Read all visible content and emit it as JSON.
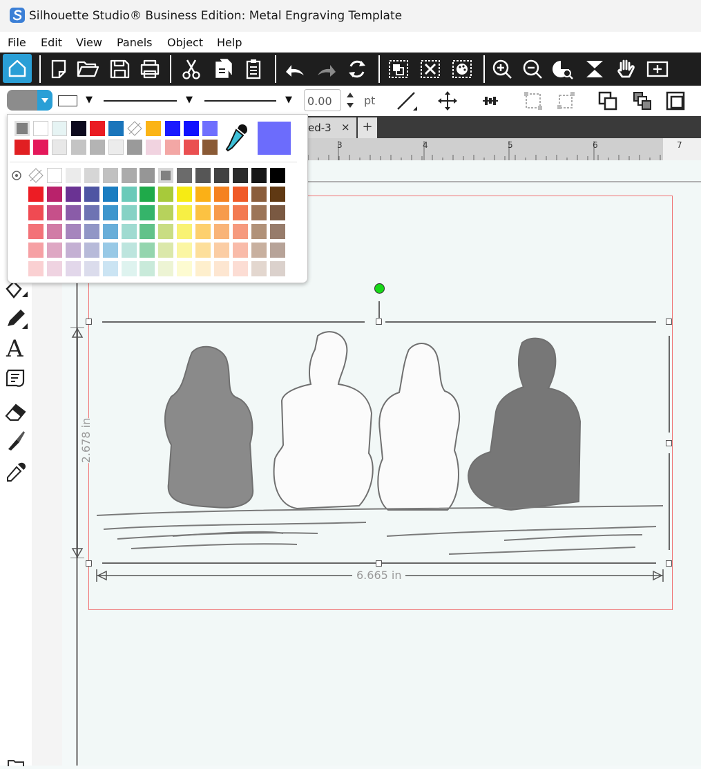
{
  "window": {
    "title": "Silhouette Studio® Business Edition: Metal Engraving Template"
  },
  "menu": [
    "File",
    "Edit",
    "View",
    "Panels",
    "Object",
    "Help"
  ],
  "toolbar": {
    "icons": [
      "home-icon",
      "new-document-icon",
      "open-folder-icon",
      "save-icon",
      "print-icon",
      "cut-icon",
      "copy-icon",
      "paste-icon",
      "undo-icon",
      "redo-icon",
      "replicate-icon",
      "group-icon",
      "ungroup-icon",
      "color-fill-icon",
      "zoom-in-icon",
      "zoom-out-icon",
      "zoom-select-icon",
      "fit-to-page-icon",
      "pan-hand-icon",
      "zoom-to-fit-icon"
    ]
  },
  "stylebar": {
    "line_width": "0.00",
    "line_unit": "pt",
    "fill_color": "#8c8c8c"
  },
  "tabs": [
    {
      "label": "ed-3",
      "close": "×"
    }
  ],
  "tab_add": "+",
  "ruler": {
    "labels": [
      "3",
      "4",
      "5",
      "6",
      "7"
    ]
  },
  "selection": {
    "width": "6.665 in",
    "height": "2.678 in"
  },
  "color_picker": {
    "recent_colors": [
      [
        "#808080",
        "#ffffff",
        "#e6f4f4",
        "#0d0a1e",
        "#ea1c23",
        "#1a75bb",
        "transparent",
        "#fbb416",
        "#1a1aff",
        "#1111ff",
        "#6f6ffe"
      ],
      [
        "#e11f22",
        "#e4195b",
        "#e8e8e8",
        "#c4c4c4",
        "#b4b4b4",
        "#ececec",
        "#9a9a9a",
        "#f1d3e0",
        "#f3a7a5",
        "#ea4f51",
        "#8a5a35"
      ]
    ],
    "selected_color": "#6c6cfc",
    "palette": [
      [
        "transparent",
        "#ffffff",
        "#ebebeb",
        "#d6d6d6",
        "#c1c1c1",
        "#ababab",
        "#969696",
        "#808080",
        "#6b6b6b",
        "#565656",
        "#414141",
        "#2b2b2b",
        "#161616",
        "#000000"
      ],
      [
        "#ed1c24",
        "#b9226b",
        "#6a3393",
        "#4e55a3",
        "#1a7dc1",
        "#6acab9",
        "#1faa4a",
        "#a7ca3a",
        "#f6eb14",
        "#fbb016",
        "#f58221",
        "#f05a28",
        "#8b5e3c",
        "#603913"
      ],
      [
        "#f04a52",
        "#c6508a",
        "#8a5ca8",
        "#6e73b3",
        "#3e96cd",
        "#86d2c5",
        "#35b46a",
        "#b7d25c",
        "#f7ef44",
        "#fcc242",
        "#f79b4c",
        "#f37a52",
        "#9c7558",
        "#7a5942"
      ],
      [
        "#f37278",
        "#d17ca6",
        "#a685bd",
        "#9196c6",
        "#68aed9",
        "#a0dbd1",
        "#62c28a",
        "#c9dd83",
        "#f9f274",
        "#fdd06e",
        "#f9b478",
        "#f69a7e",
        "#b19279",
        "#977c6b"
      ],
      [
        "#f6a0a4",
        "#dea7c3",
        "#c4b0d3",
        "#b7bad9",
        "#98c9e6",
        "#bde5de",
        "#94d5ae",
        "#dbe8aa",
        "#fbf6a3",
        "#fddf9b",
        "#fbcda4",
        "#f9bba9",
        "#c8b09f",
        "#b7a398"
      ],
      [
        "#fad0d2",
        "#efd3e1",
        "#e2d7ea",
        "#dbdcec",
        "#cbe4f3",
        "#def3ef",
        "#c9eada",
        "#edf4d4",
        "#fdfbd1",
        "#feefcd",
        "#fde6d1",
        "#fcddd4",
        "#e3d7cf",
        "#dbd1cc"
      ]
    ]
  }
}
